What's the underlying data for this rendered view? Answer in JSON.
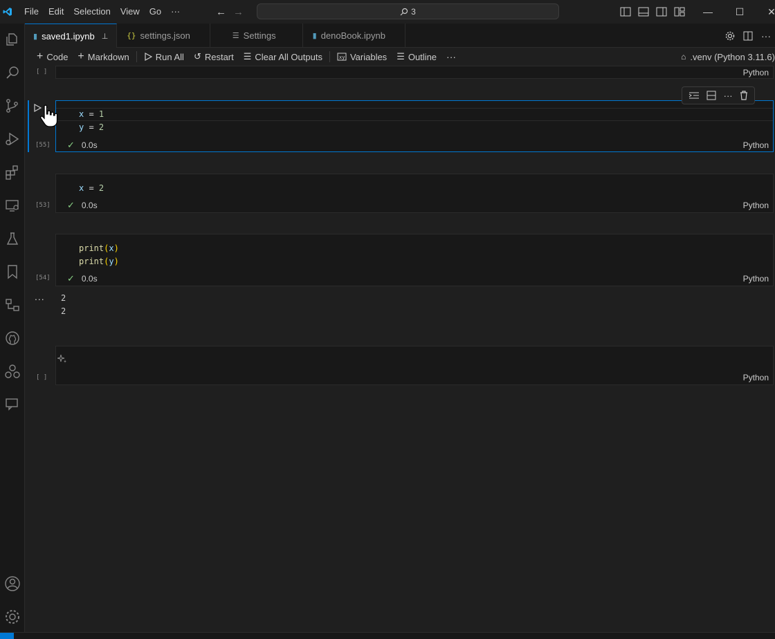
{
  "menu": [
    "File",
    "Edit",
    "Selection",
    "View",
    "Go"
  ],
  "command_center": {
    "text": "3"
  },
  "tabs": [
    {
      "label": "saved1.ipynb",
      "icon": "notebook-icon",
      "active": true,
      "pinned": true
    },
    {
      "label": "settings.json",
      "icon": "braces-icon",
      "active": false
    },
    {
      "label": "Settings",
      "icon": "settings-lines-icon",
      "active": false
    },
    {
      "label": "denoBook.ipynb",
      "icon": "notebook-icon",
      "active": false
    }
  ],
  "toolbar": {
    "code": "Code",
    "markdown": "Markdown",
    "run_all": "Run All",
    "restart": "Restart",
    "clear_all_outputs": "Clear All Outputs",
    "variables": "Variables",
    "outline": "Outline",
    "kernel": ".venv (Python 3.11.6)"
  },
  "cells": [
    {
      "exec_count": "[ ]",
      "language": "Python"
    },
    {
      "exec_count": "[55]",
      "code": [
        "x = 1",
        "y = 2"
      ],
      "duration": "0.0s",
      "language": "Python",
      "selected": true
    },
    {
      "exec_count": "[53]",
      "code": [
        "x = 2"
      ],
      "duration": "0.0s",
      "language": "Python"
    },
    {
      "exec_count": "[54]",
      "code": [
        "print(x)",
        "print(y)"
      ],
      "duration": "0.0s",
      "language": "Python",
      "output": [
        "2",
        "2"
      ]
    },
    {
      "exec_count": "[ ]",
      "language": "Python"
    }
  ],
  "output_more": "...",
  "colors": {
    "accent": "#0078d4",
    "check": "#89d185",
    "background": "#1f1f1f"
  }
}
